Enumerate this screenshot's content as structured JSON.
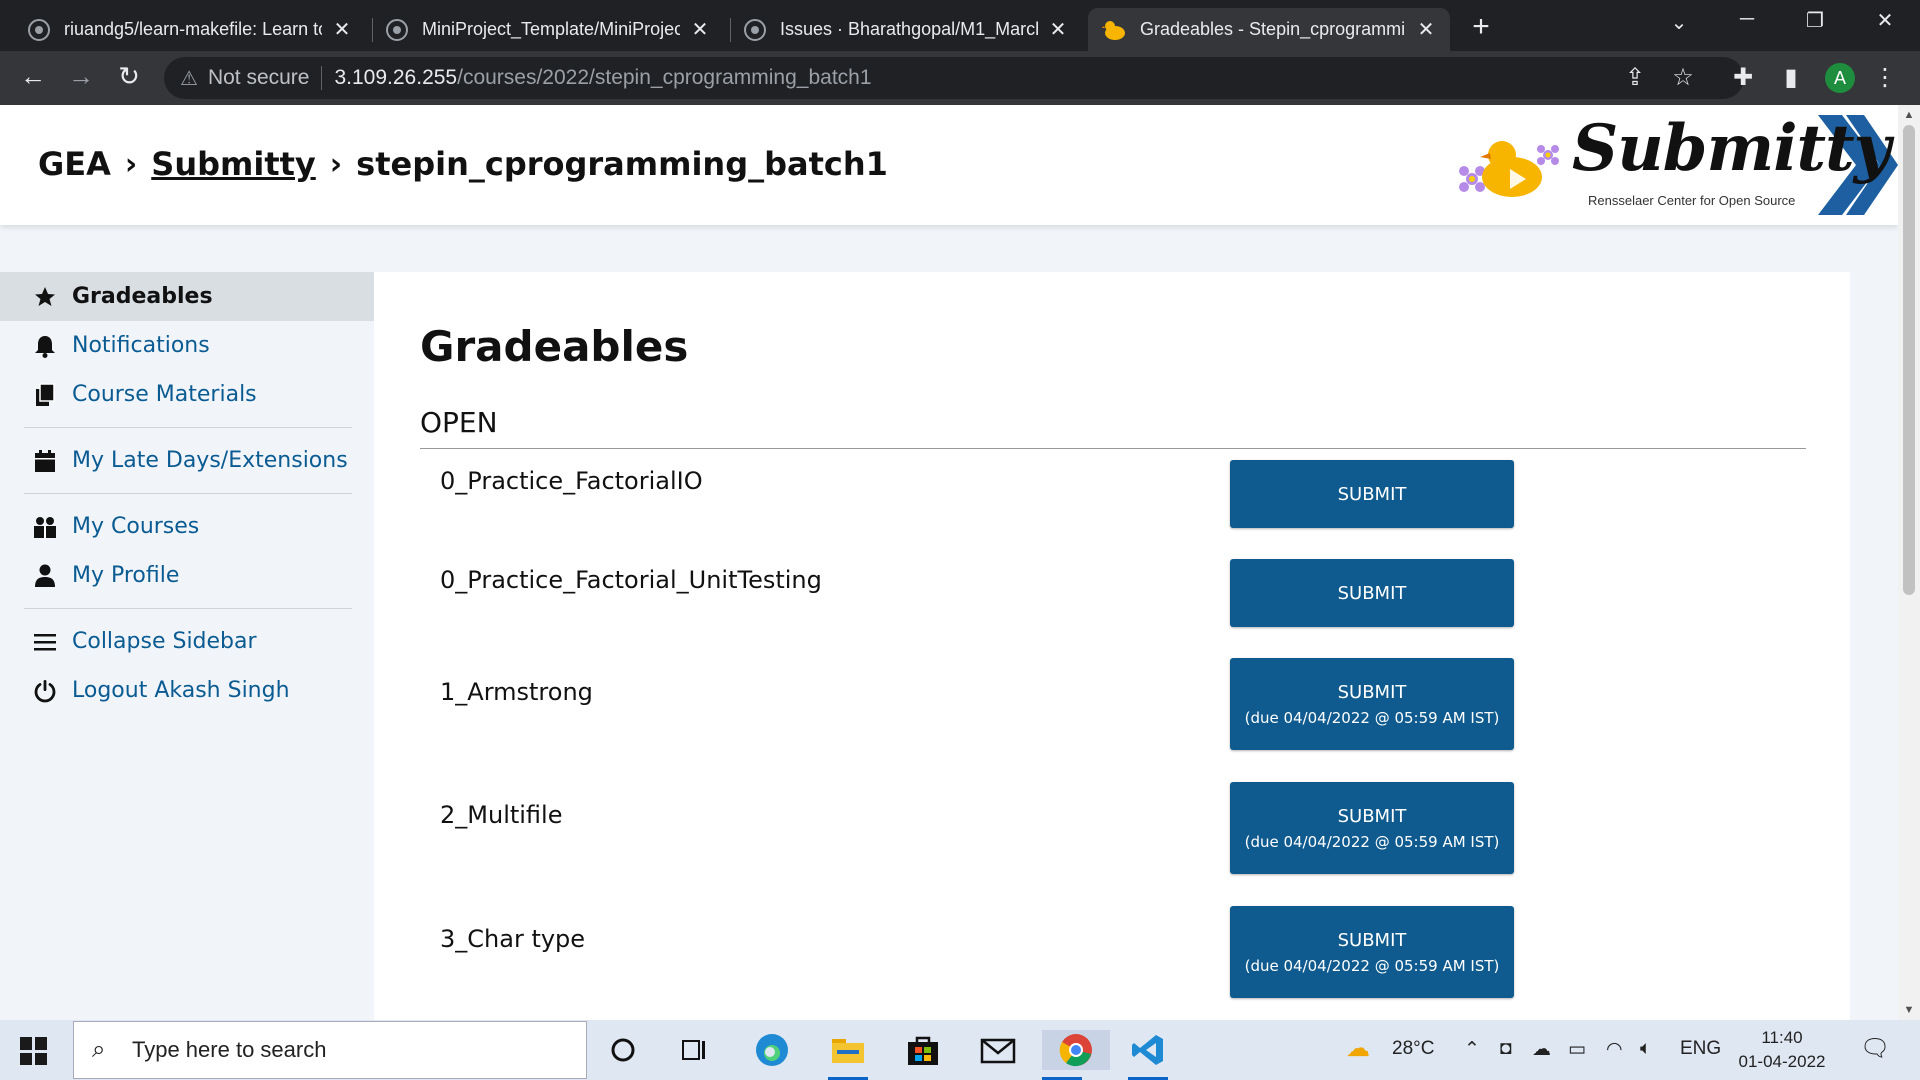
{
  "browser": {
    "tabs": [
      {
        "title": "riuandg5/learn-makefile: Learn to"
      },
      {
        "title": "MiniProject_Template/MiniProjec"
      },
      {
        "title": "Issues · Bharathgopal/M1_March"
      },
      {
        "title": "Gradeables - Stepin_cprogrammi"
      }
    ],
    "url_warning": "Not secure",
    "url_host": "3.109.26.255",
    "url_path": "/courses/2022/stepin_cprogramming_batch1",
    "profile_initial": "A"
  },
  "header": {
    "crumb_1": "GEA",
    "crumb_2": "Submitty",
    "crumb_3": "stepin_cprogramming_batch1",
    "logo_text": "Submitty",
    "logo_sub": "Rensselaer Center for Open Source"
  },
  "sidebar": {
    "items": [
      {
        "label": "Gradeables",
        "icon": "star-icon"
      },
      {
        "label": "Notifications",
        "icon": "bell-icon"
      },
      {
        "label": "Course Materials",
        "icon": "files-icon"
      },
      {
        "label": "My Late Days/Extensions",
        "icon": "calendar-icon"
      },
      {
        "label": "My Courses",
        "icon": "people-icon"
      },
      {
        "label": "My Profile",
        "icon": "user-icon"
      },
      {
        "label": "Collapse Sidebar",
        "icon": "menu-icon"
      },
      {
        "label": "Logout Akash Singh",
        "icon": "power-icon"
      }
    ]
  },
  "main": {
    "title": "Gradeables",
    "section": "OPEN",
    "gradeables": [
      {
        "name": "0_Practice_FactorialIO",
        "button": "SUBMIT",
        "due": ""
      },
      {
        "name": "0_Practice_Factorial_UnitTesting",
        "button": "SUBMIT",
        "due": ""
      },
      {
        "name": "1_Armstrong",
        "button": "SUBMIT",
        "due": "(due 04/04/2022 @ 05:59 AM IST)"
      },
      {
        "name": "2_Multifile",
        "button": "SUBMIT",
        "due": "(due 04/04/2022 @ 05:59 AM IST)"
      },
      {
        "name": "3_Char type",
        "button": "SUBMIT",
        "due": "(due 04/04/2022 @ 05:59 AM IST)"
      }
    ]
  },
  "taskbar": {
    "search_placeholder": "Type here to search",
    "weather": "28°C",
    "lang": "ENG",
    "time": "11:40",
    "date": "01-04-2022"
  },
  "colors": {
    "accent": "#0f5a8e",
    "link": "#0b5b93",
    "page_bg": "#f1f5f9"
  }
}
